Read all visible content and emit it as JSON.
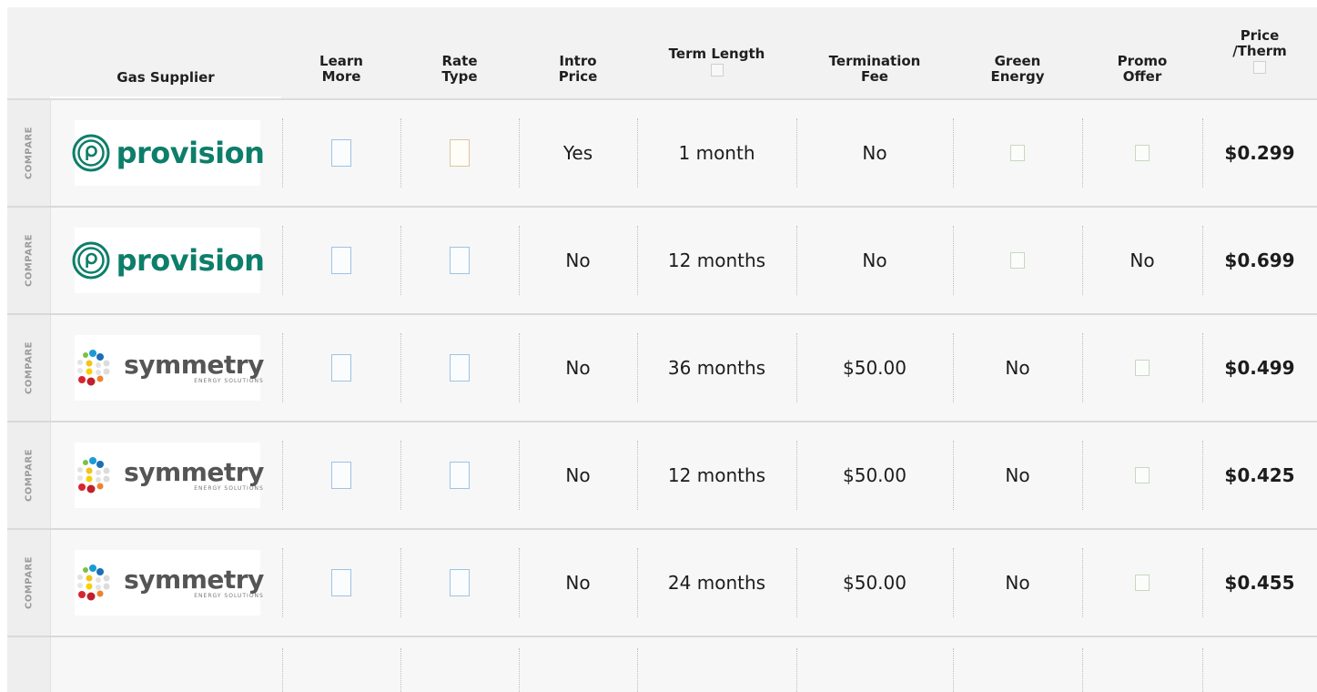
{
  "headers": {
    "supplier": "Gas Supplier",
    "learn_more": [
      "Learn",
      "More"
    ],
    "rate_type": [
      "Rate",
      "Type"
    ],
    "intro_price": [
      "Intro",
      "Price"
    ],
    "term_length": "Term Length",
    "termination_fee": [
      "Termination",
      "Fee"
    ],
    "green_energy": [
      "Green",
      "Energy"
    ],
    "promo_offer": [
      "Promo",
      "Offer"
    ],
    "price_therm": [
      "Price",
      "/Therm"
    ]
  },
  "compare_label": "COMPARE",
  "brands": {
    "provision": {
      "name": "provision",
      "color": "#0d7e6a"
    },
    "symmetry": {
      "name": "symmetry",
      "sub": "ENERGY SOLUTIONS"
    }
  },
  "rows": [
    {
      "brand": "provision",
      "intro": "Yes",
      "term": "1 month",
      "fee": "No",
      "green": "",
      "promo": "",
      "price": "$0.299"
    },
    {
      "brand": "provision",
      "intro": "No",
      "term": "12 months",
      "fee": "No",
      "green": "",
      "promo": "No",
      "price": "$0.699"
    },
    {
      "brand": "symmetry",
      "intro": "No",
      "term": "36 months",
      "fee": "$50.00",
      "green": "No",
      "promo": "",
      "price": "$0.499"
    },
    {
      "brand": "symmetry",
      "intro": "No",
      "term": "12 months",
      "fee": "$50.00",
      "green": "No",
      "promo": "",
      "price": "$0.425"
    },
    {
      "brand": "symmetry",
      "intro": "No",
      "term": "24 months",
      "fee": "$50.00",
      "green": "No",
      "promo": "",
      "price": "$0.455"
    }
  ]
}
